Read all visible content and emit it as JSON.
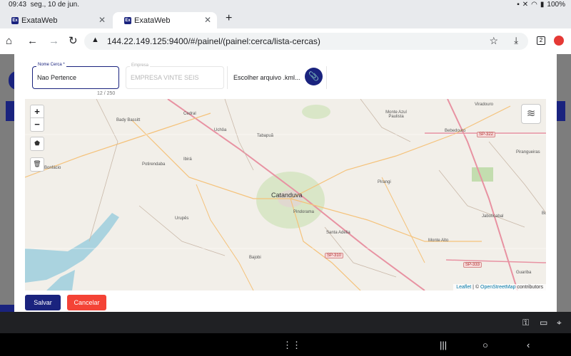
{
  "status": {
    "time": "09:43",
    "date": "seg., 10 de jun.",
    "battery": "100%"
  },
  "tabs": [
    {
      "title": "ExataWeb",
      "active": false
    },
    {
      "title": "ExataWeb",
      "active": true
    }
  ],
  "favicon_text": "Ex",
  "address": {
    "url": "144.22.149.125:9400/#/painel/(painel:cerca/lista-cercas)",
    "tab_count": "2"
  },
  "form": {
    "name_label": "Nome Cerca *",
    "name_value": "Nao Pertence",
    "name_counter": "12 / 250",
    "empresa_label": "Empresa",
    "empresa_value": "EMPRESA VINTE SEIS",
    "file_text": "Escolher arquivo .kml..."
  },
  "map": {
    "cities": [
      "Catanduva"
    ],
    "places": [
      "Cedral",
      "Bady Bassitt",
      "Uchôa",
      "Tabapuã",
      "Monte Azul Paulista",
      "Viradouro",
      "Bebedouro",
      "Pirangueiras",
      "e Bonfácio",
      "Potirendaba",
      "Ibirá",
      "Pirangi",
      "Urupês",
      "Pindorama",
      "Santa Adélia",
      "Monte Alto",
      "Jaboticabal",
      "Bajobi",
      "Guariba",
      "Bu"
    ],
    "shields": [
      "SP-322",
      "SP-310",
      "SP-333"
    ],
    "attribution": {
      "leaflet": "Leaflet",
      "separator": " | © ",
      "osm": "OpenStreetMap",
      "suffix": " contributors"
    },
    "zoom_in": "+",
    "zoom_out": "−"
  },
  "buttons": {
    "save": "Salvar",
    "cancel": "Cancelar"
  },
  "colors": {
    "primary": "#1a237e",
    "danger": "#f44336",
    "map_bg": "#f2efe9"
  }
}
